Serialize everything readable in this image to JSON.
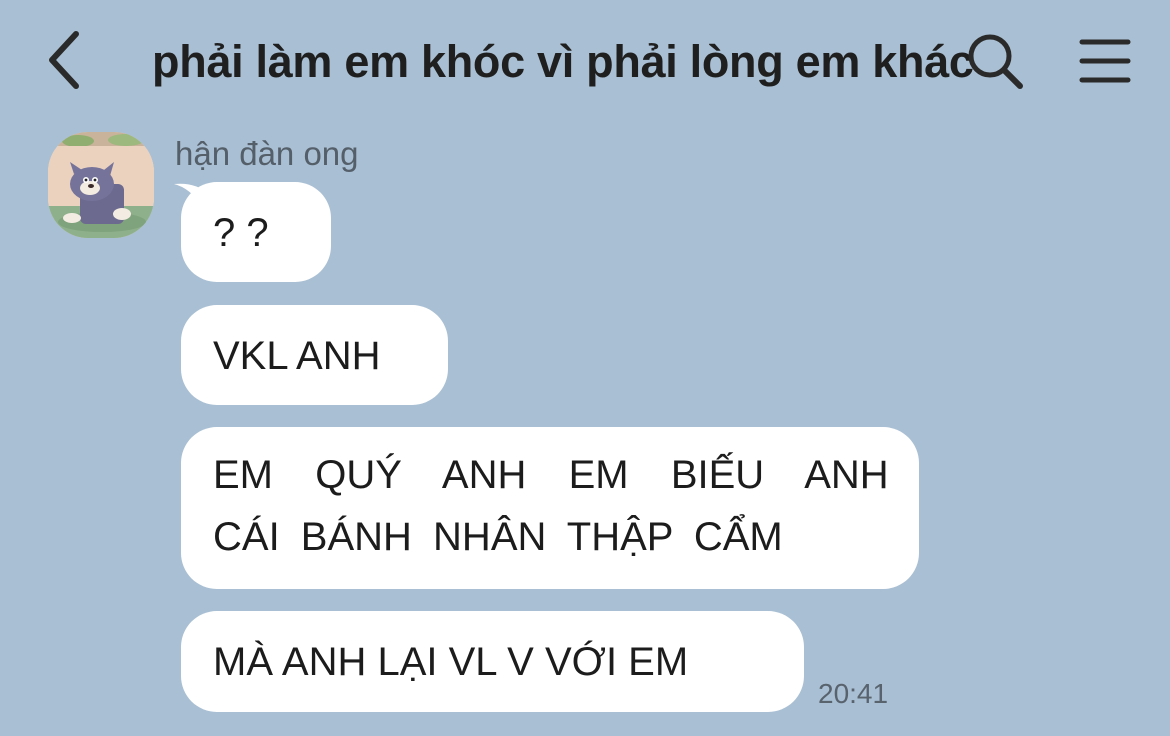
{
  "header": {
    "title": "phải làm em khóc vì phải lòng em khác",
    "back_icon": "chevron-left-icon",
    "search_icon": "search-icon",
    "menu_icon": "hamburger-menu-icon"
  },
  "chat": {
    "sender_name": "hận đàn ong",
    "messages": [
      {
        "text": "? ?"
      },
      {
        "text": "VKL ANH"
      },
      {
        "lines": [
          "EM  QUÝ  ANH  EM  BIẾU  ANH",
          "CÁI BÁNH NHÂN THẬP CẨM"
        ]
      },
      {
        "text": "MÀ ANH LẠI VL V VỚI EM"
      }
    ],
    "last_time": "20:41"
  },
  "colors": {
    "background": "#a9bfd3",
    "bubble": "#ffffff",
    "text": "#1c1c1c",
    "muted": "#545f6a"
  }
}
